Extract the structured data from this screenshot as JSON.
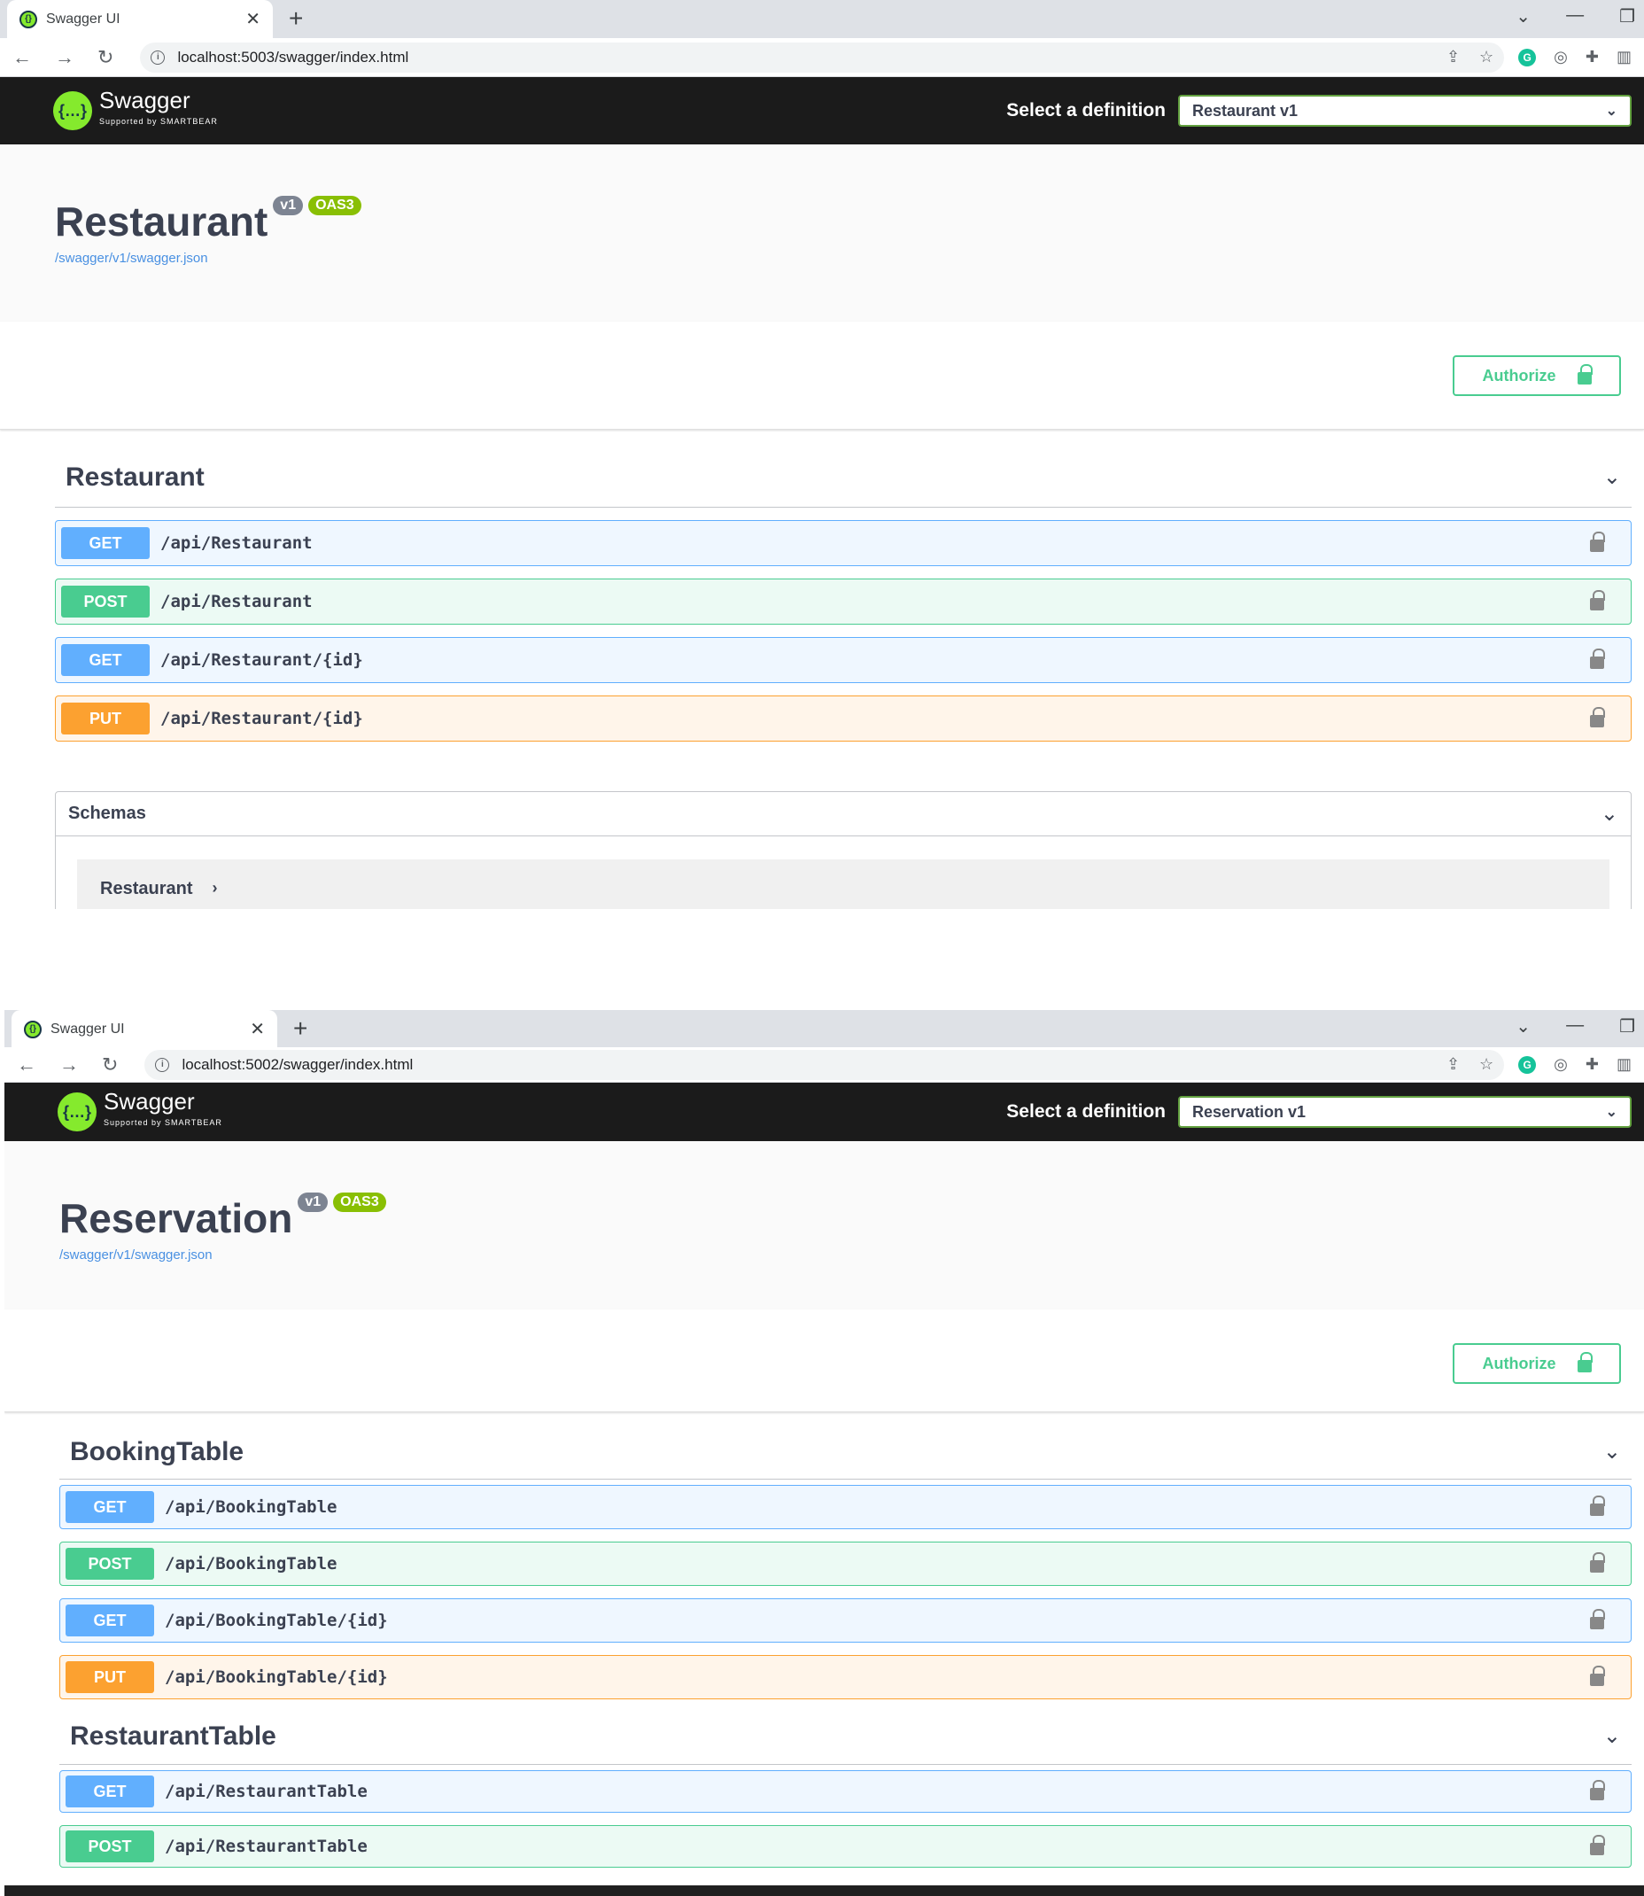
{
  "shot1": {
    "tab_title": "Swagger UI",
    "url": "localhost:5003/swagger/index.html",
    "brand": "Swagger",
    "brand_sub": "Supported by SMARTBEAR",
    "select_label": "Select a definition",
    "selected_definition": "Restaurant v1",
    "api_title": "Restaurant",
    "version_badge": "v1",
    "oas_badge": "OAS3",
    "json_link": "/swagger/v1/swagger.json",
    "authorize": "Authorize",
    "tag": "Restaurant",
    "operations": [
      {
        "method": "GET",
        "path": "/api/Restaurant"
      },
      {
        "method": "POST",
        "path": "/api/Restaurant"
      },
      {
        "method": "GET",
        "path": "/api/Restaurant/{id}"
      },
      {
        "method": "PUT",
        "path": "/api/Restaurant/{id}"
      }
    ],
    "schemas_title": "Schemas",
    "schema_model": "Restaurant"
  },
  "shot2": {
    "tab_title": "Swagger UI",
    "url": "localhost:5002/swagger/index.html",
    "brand": "Swagger",
    "brand_sub": "Supported by SMARTBEAR",
    "select_label": "Select a definition",
    "selected_definition": "Reservation v1",
    "api_title": "Reservation",
    "version_badge": "v1",
    "oas_badge": "OAS3",
    "json_link": "/swagger/v1/swagger.json",
    "authorize": "Authorize",
    "tags": [
      {
        "name": "BookingTable",
        "operations": [
          {
            "method": "GET",
            "path": "/api/BookingTable"
          },
          {
            "method": "POST",
            "path": "/api/BookingTable"
          },
          {
            "method": "GET",
            "path": "/api/BookingTable/{id}"
          },
          {
            "method": "PUT",
            "path": "/api/BookingTable/{id}"
          }
        ]
      },
      {
        "name": "RestaurantTable",
        "operations": [
          {
            "method": "GET",
            "path": "/api/RestaurantTable"
          },
          {
            "method": "POST",
            "path": "/api/RestaurantTable"
          }
        ]
      }
    ]
  },
  "colors": {
    "get": "#61affe",
    "post": "#49cc90",
    "put": "#fca130",
    "brand": "#85ea2d"
  }
}
